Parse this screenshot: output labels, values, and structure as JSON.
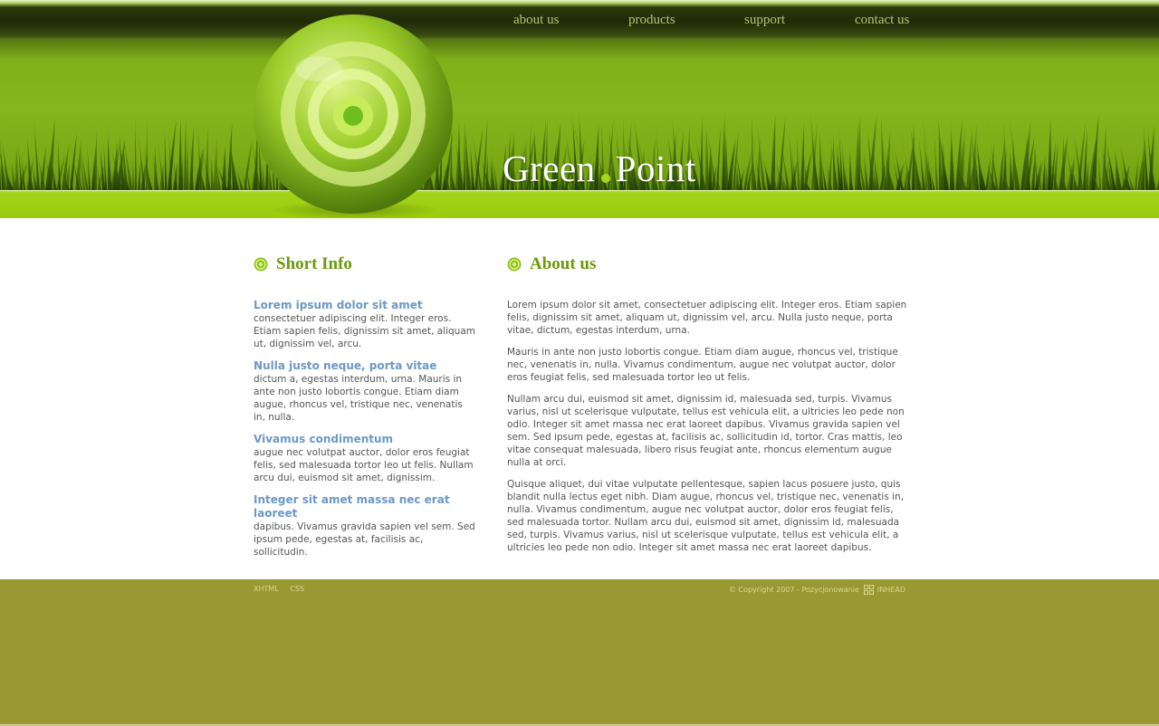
{
  "nav": {
    "items": [
      {
        "label": "about us"
      },
      {
        "label": "products"
      },
      {
        "label": "support"
      },
      {
        "label": "contact us"
      }
    ]
  },
  "brand": {
    "word1": "Green",
    "word2": "Point",
    "icon": "lime-target-icon"
  },
  "colors": {
    "header_green": "#85b61c",
    "band_green": "#9ccb0c",
    "title_green": "#6a9a0a",
    "link_blue": "#6c98c8",
    "footer_olive": "#999933"
  },
  "short_info": {
    "title": "Short Info",
    "items": [
      {
        "heading": "Lorem ipsum dolor sit amet",
        "body": "consectetuer adipiscing elit. Integer eros. Etiam sapien felis, dignissim sit amet, aliquam ut, dignissim vel, arcu."
      },
      {
        "heading": "Nulla justo neque, porta vitae",
        "body": "dictum a, egestas interdum, urna. Mauris in ante non justo lobortis congue. Etiam diam augue, rhoncus vel, tristique nec, venenatis in, nulla."
      },
      {
        "heading": "Vivamus condimentum",
        "body": "augue nec volutpat auctor, dolor eros feugiat felis, sed malesuada tortor leo ut felis. Nullam arcu dui, euismod sit amet, dignissim."
      },
      {
        "heading": "Integer sit amet massa nec erat laoreet",
        "body": "dapibus. Vivamus gravida sapien vel sem. Sed ipsum pede, egestas at, facilisis ac, sollicitudin."
      }
    ]
  },
  "about": {
    "title": "About us",
    "paragraphs": [
      "Lorem ipsum dolor sit amet, consectetuer adipiscing elit. Integer eros. Etiam sapien felis, dignissim sit amet, aliquam ut, dignissim vel, arcu. Nulla justo neque, porta vitae, dictum, egestas interdum, urna.",
      "Mauris in ante non justo lobortis congue. Etiam diam augue, rhoncus vel, tristique nec, venenatis in, nulla. Vivamus condimentum, augue nec volutpat auctor, dolor eros feugiat felis, sed malesuada tortor leo ut felis.",
      "Nullam arcu dui, euismod sit amet, dignissim id, malesuada sed, turpis. Vivamus varius, nisl ut scelerisque vulputate, tellus est vehicula elit, a ultricies leo pede non odio. Integer sit amet massa nec erat laoreet dapibus. Vivamus gravida sapien vel sem. Sed ipsum pede, egestas at, facilisis ac, sollicitudin id, tortor. Cras mattis, leo vitae consequat malesuada, libero risus feugiat ante, rhoncus elementum augue nulla at orci.",
      "Quisque aliquet, dui vitae vulputate pellentesque, sapien lacus posuere justo, quis blandit nulla lectus eget nibh. Diam augue, rhoncus vel, tristique nec, venenatis in, nulla. Vivamus condimentum, augue nec volutpat auctor, dolor eros feugiat felis, sed malesuada tortor. Nullam arcu dui, euismod sit amet, dignissim id, malesuada sed, turpis. Vivamus varius, nisl ut scelerisque vulputate, tellus est vehicula elit, a ultricies leo pede non odio. Integer sit amet massa nec erat laoreet dapibus."
    ]
  },
  "footer": {
    "links": [
      {
        "label": "XHTML"
      },
      {
        "label": "CSS"
      }
    ],
    "copyright": "© Copyright 2007 - Pozycjonowanie",
    "credit": "INHEAD",
    "credit_icon": "inhead-logo-icon"
  }
}
